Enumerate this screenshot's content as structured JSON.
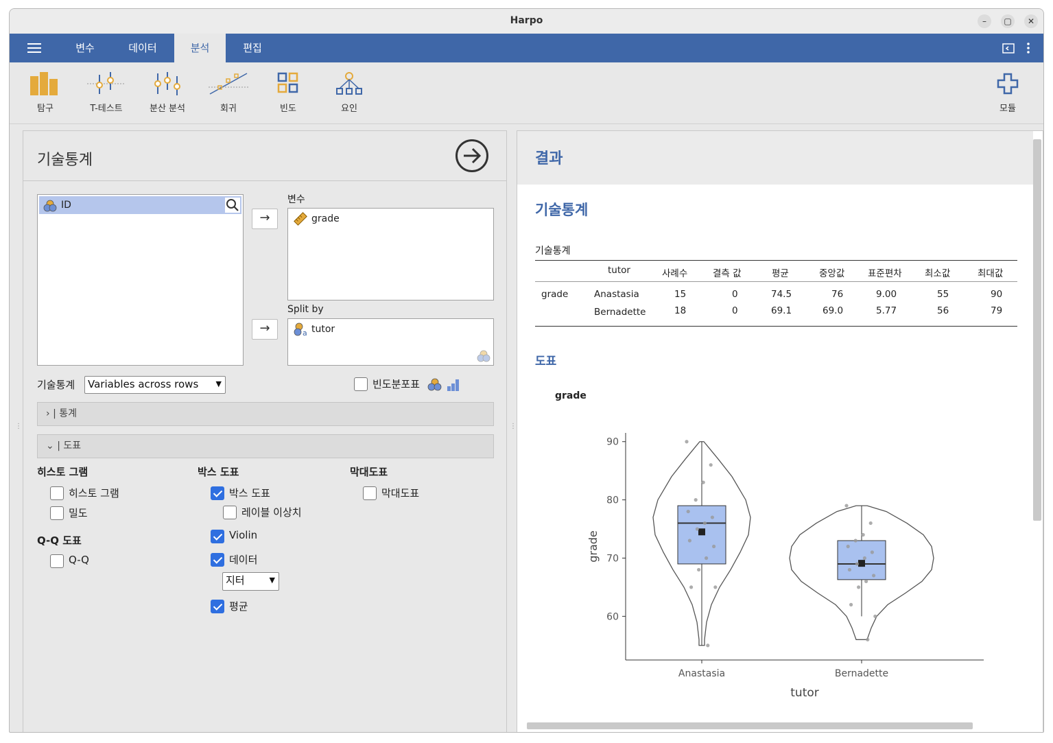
{
  "window": {
    "title": "Harpo",
    "minimize": "–",
    "maximize": "▢",
    "close": "✕"
  },
  "menu": {
    "tabs": [
      {
        "label": "변수"
      },
      {
        "label": "데이터"
      },
      {
        "label": "분석"
      },
      {
        "label": "편집"
      }
    ],
    "active_tab": "분석"
  },
  "ribbon": {
    "items": [
      {
        "label": "탐구",
        "icon": "exploration-icon"
      },
      {
        "label": "T-테스트",
        "icon": "ttest-icon"
      },
      {
        "label": "분산 분석",
        "icon": "anova-icon"
      },
      {
        "label": "회귀",
        "icon": "regression-icon"
      },
      {
        "label": "빈도",
        "icon": "frequencies-icon"
      },
      {
        "label": "요인",
        "icon": "factor-icon"
      }
    ],
    "modules_label": "모듈"
  },
  "analysis": {
    "title": "기술통계",
    "source_vars": [
      {
        "name": "ID"
      }
    ],
    "variables_label": "변수",
    "variables": [
      {
        "name": "grade"
      }
    ],
    "splitby_label": "Split by",
    "splitby": [
      {
        "name": "tutor"
      }
    ],
    "descriptives_label": "기술통계",
    "descriptives_select": "Variables across rows",
    "freq_table_label": "빈도분포표",
    "freq_table_checked": false,
    "sections": {
      "stats": "통계",
      "plots": "도표"
    },
    "plots": {
      "histogram_head": "히스토 그램",
      "histogram": {
        "label": "히스토 그램",
        "checked": false
      },
      "density": {
        "label": "밀도",
        "checked": false
      },
      "qq_head": "Q-Q 도표",
      "qq": {
        "label": "Q-Q",
        "checked": false
      },
      "box_head": "박스 도표",
      "box": {
        "label": "박스 도표",
        "checked": true
      },
      "label_outliers": {
        "label": "레이블 이상치",
        "checked": false
      },
      "violin": {
        "label": "Violin",
        "checked": true
      },
      "data": {
        "label": "데이터",
        "checked": true
      },
      "data_type": "지터",
      "mean": {
        "label": "평균",
        "checked": true
      },
      "bar_head": "막대도표",
      "bar": {
        "label": "막대도표",
        "checked": false
      }
    }
  },
  "results": {
    "header": "결과",
    "title": "기술통계",
    "table_title": "기술통계",
    "columns": [
      "tutor",
      "사례수",
      "결측 값",
      "평균",
      "중앙값",
      "표준편차",
      "최소값",
      "최대값"
    ],
    "rows": [
      {
        "var": "grade",
        "tutor": "Anastasia",
        "n": "15",
        "missing": "0",
        "mean": "74.5",
        "median": "76",
        "sd": "9.00",
        "min": "55",
        "max": "90"
      },
      {
        "var": "",
        "tutor": "Bernadette",
        "n": "18",
        "missing": "0",
        "mean": "69.1",
        "median": "69.0",
        "sd": "5.77",
        "min": "56",
        "max": "79"
      }
    ],
    "plots_heading": "도표",
    "plot_title": "grade"
  },
  "chart_data": {
    "type": "box",
    "title": "grade",
    "xlabel": "tutor",
    "ylabel": "grade",
    "ylim": [
      52.5,
      91.5
    ],
    "yticks": [
      60,
      70,
      80,
      90
    ],
    "categories": [
      "Anastasia",
      "Bernadette"
    ],
    "box": [
      {
        "name": "Anastasia",
        "q1": 69,
        "median": 76,
        "q3": 79,
        "min": 55,
        "max": 90,
        "mean": 74.5
      },
      {
        "name": "Bernadette",
        "q1": 66.3,
        "median": 69,
        "q3": 73,
        "min": 60,
        "max": 79,
        "mean": 69.1
      }
    ],
    "violin_color": "#555555",
    "box_color": "#a9c1ef",
    "points": [
      {
        "group": "Anastasia",
        "values": [
          90,
          86,
          83,
          80,
          78,
          77,
          76,
          75,
          73,
          72,
          70,
          68,
          65,
          65,
          55
        ]
      },
      {
        "group": "Bernadette",
        "values": [
          79,
          76,
          74,
          73,
          72,
          71,
          70,
          69,
          68,
          67,
          66,
          65,
          62,
          60,
          56
        ]
      }
    ]
  }
}
